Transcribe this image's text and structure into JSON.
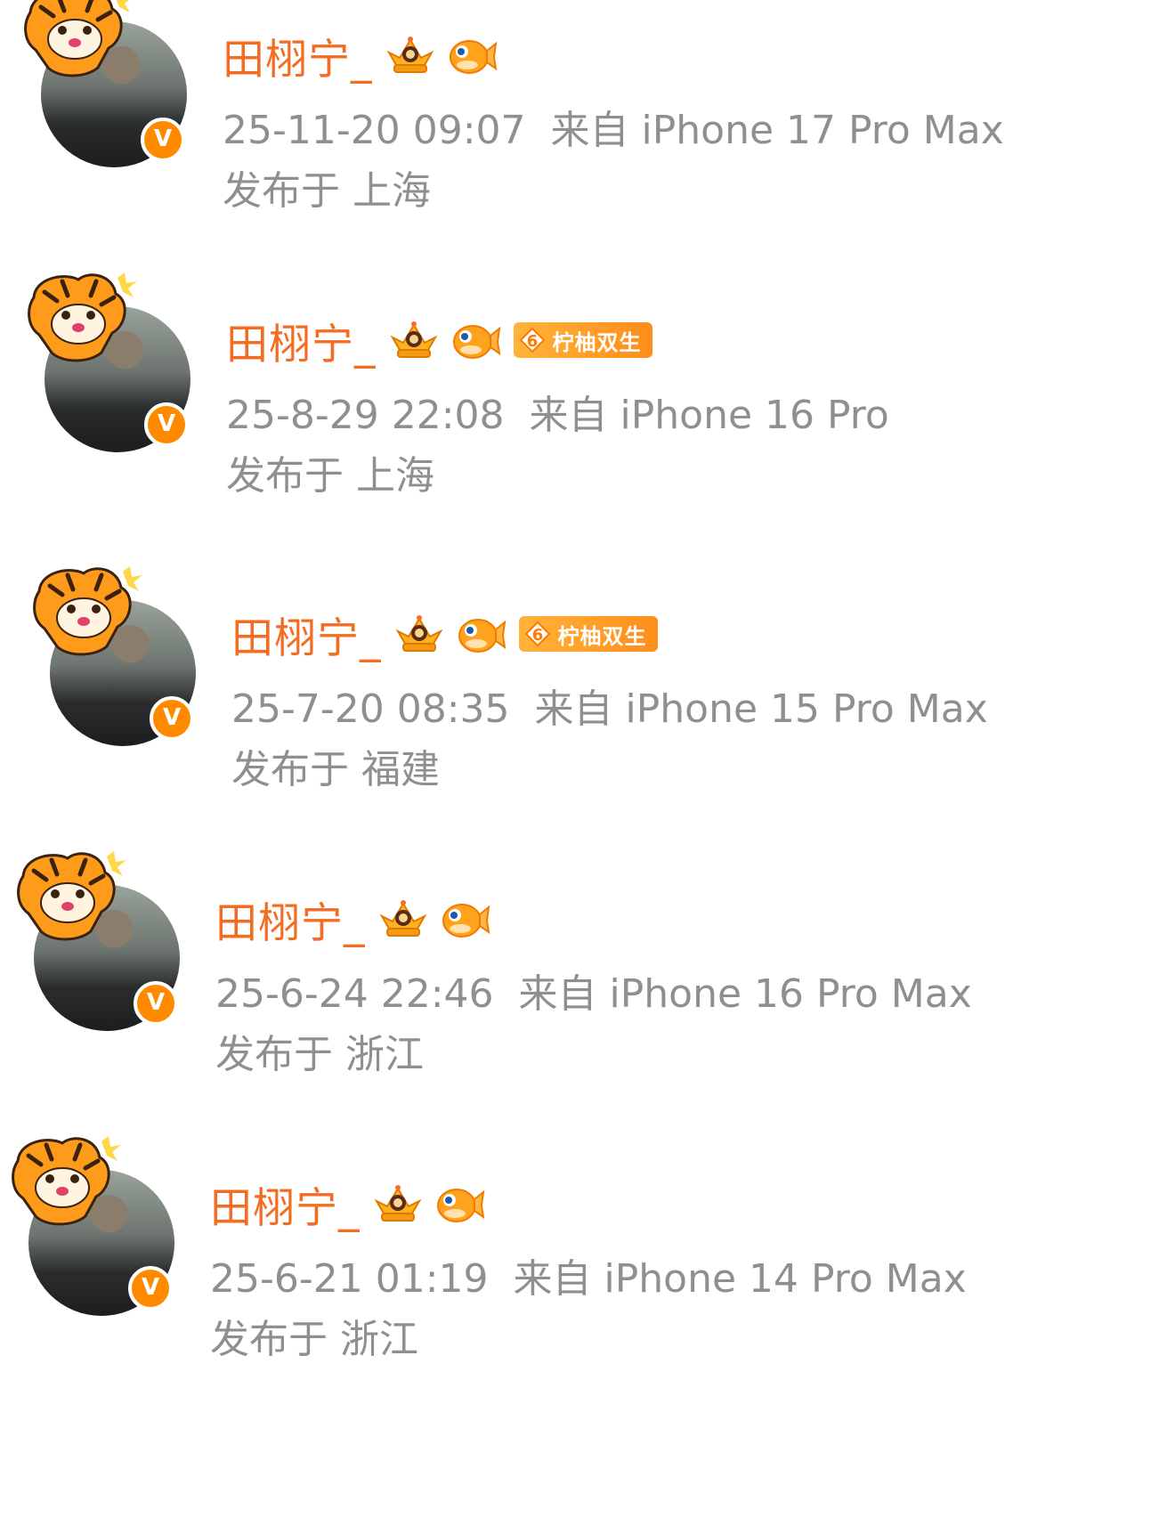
{
  "posts": [
    {
      "username": "田栩宁_",
      "time": "25-11-20 09:07",
      "source": "来自 iPhone 17 Pro Max",
      "location": "发布于 上海",
      "has_fan_badge": false
    },
    {
      "username": "田栩宁_",
      "time": "25-8-29 22:08",
      "source": "来自 iPhone 16 Pro",
      "location": "发布于 上海",
      "has_fan_badge": true,
      "fan_badge": {
        "level": "6",
        "name": "柠柚双生"
      }
    },
    {
      "username": "田栩宁_",
      "time": "25-7-20 08:35",
      "source": "来自 iPhone 15 Pro Max",
      "location": "发布于 福建",
      "has_fan_badge": true,
      "fan_badge": {
        "level": "6",
        "name": "柠柚双生"
      }
    },
    {
      "username": "田栩宁_",
      "time": "25-6-24 22:46",
      "source": "来自 iPhone 16 Pro Max",
      "location": "发布于 浙江",
      "has_fan_badge": false
    },
    {
      "username": "田栩宁_",
      "time": "25-6-21 01:19",
      "source": "来自 iPhone 14 Pro Max",
      "location": "发布于 浙江",
      "has_fan_badge": false
    }
  ],
  "verified_badge_letter": "V",
  "icons": {
    "crown": "crown-badge-icon",
    "pufferfish": "pufferfish-badge-icon",
    "tiger": "tiger-pendant-icon",
    "verified": "verified-v-icon"
  },
  "colors": {
    "username": "#f36c21",
    "meta": "#8f8f8f",
    "verified": "#ff8a00",
    "fan_badge": "#ff9a22"
  }
}
